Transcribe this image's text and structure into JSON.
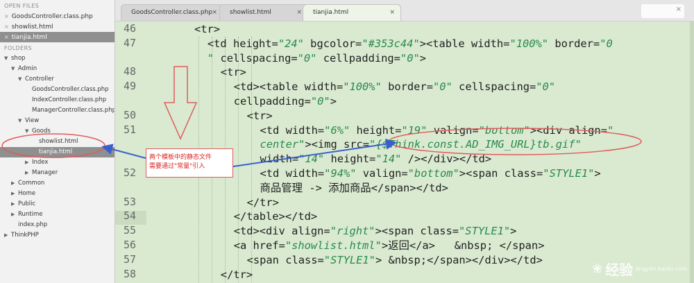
{
  "sidebar": {
    "open_files_header": "OPEN FILES",
    "open_files": [
      {
        "name": "GoodsController.class.php",
        "active": false
      },
      {
        "name": "showlist.html",
        "active": false
      },
      {
        "name": "tianjia.html",
        "active": true
      }
    ],
    "folders_header": "FOLDERS",
    "tree": [
      {
        "label": "shop",
        "depth": 0,
        "state": "open"
      },
      {
        "label": "Admin",
        "depth": 1,
        "state": "open"
      },
      {
        "label": "Controller",
        "depth": 2,
        "state": "open"
      },
      {
        "label": "GoodsController.class.php",
        "depth": 3,
        "state": "file"
      },
      {
        "label": "IndexController.class.php",
        "depth": 3,
        "state": "file"
      },
      {
        "label": "ManagerController.class.php",
        "depth": 3,
        "state": "file"
      },
      {
        "label": "View",
        "depth": 2,
        "state": "open"
      },
      {
        "label": "Goods",
        "depth": 3,
        "state": "open"
      },
      {
        "label": "showlist.html",
        "depth": 4,
        "state": "file"
      },
      {
        "label": "tianjia.html",
        "depth": 4,
        "state": "file",
        "selected": true
      },
      {
        "label": "Index",
        "depth": 3,
        "state": "closed"
      },
      {
        "label": "Manager",
        "depth": 3,
        "state": "closed"
      },
      {
        "label": "Common",
        "depth": 1,
        "state": "closed"
      },
      {
        "label": "Home",
        "depth": 1,
        "state": "closed"
      },
      {
        "label": "Public",
        "depth": 1,
        "state": "closed"
      },
      {
        "label": "Runtime",
        "depth": 1,
        "state": "closed"
      },
      {
        "label": "index.php",
        "depth": 1,
        "state": "file"
      },
      {
        "label": "ThinkPHP",
        "depth": 0,
        "state": "closed"
      }
    ]
  },
  "tabs": [
    {
      "label": "GoodsController.class.php",
      "close": "×",
      "active": false
    },
    {
      "label": "showlist.html",
      "close": "×",
      "active": false
    },
    {
      "label": "tianjia.html",
      "close": "×",
      "active": true
    }
  ],
  "tab_stub_close": "×",
  "editor": {
    "line_numbers": [
      "46",
      "47",
      "48",
      "49",
      "50",
      "51",
      "52",
      "53",
      "54",
      "55",
      "56",
      "57",
      "58"
    ],
    "current_line": "54",
    "code_lines": [
      [
        {
          "t": "<tr>"
        }
      ],
      [
        {
          "t": "<td height="
        },
        {
          "t": "\"24\"",
          "v": true
        },
        {
          "t": " bgcolor="
        },
        {
          "t": "\"#353c44\"",
          "v": true
        },
        {
          "t": "><table width="
        },
        {
          "t": "\"100%\"",
          "v": true
        },
        {
          "t": " border="
        },
        {
          "t": "\"0",
          "v": true
        }
      ],
      [
        {
          "t": "\"",
          "v": true
        },
        {
          "t": " cellspacing="
        },
        {
          "t": "\"0\"",
          "v": true
        },
        {
          "t": " cellpadding="
        },
        {
          "t": "\"0\"",
          "v": true
        },
        {
          "t": ">"
        }
      ],
      [
        {
          "t": "<tr>"
        }
      ],
      [
        {
          "t": "<td><table width="
        },
        {
          "t": "\"100%\"",
          "v": true
        },
        {
          "t": " border="
        },
        {
          "t": "\"0\"",
          "v": true
        },
        {
          "t": " cellspacing="
        },
        {
          "t": "\"0\"",
          "v": true
        }
      ],
      [
        {
          "t": "cellpadding="
        },
        {
          "t": "\"0\"",
          "v": true
        },
        {
          "t": ">"
        }
      ],
      [
        {
          "t": "<tr>"
        }
      ],
      [
        {
          "t": "<td width="
        },
        {
          "t": "\"6%\"",
          "v": true
        },
        {
          "t": " height="
        },
        {
          "t": "\"19\"",
          "v": true
        },
        {
          "t": " valign="
        },
        {
          "t": "\"bottom\"",
          "v": true
        },
        {
          "t": "><div align="
        },
        {
          "t": "\"",
          "v": true
        }
      ],
      [
        {
          "t": "center\"",
          "v": true
        },
        {
          "t": "><img src="
        },
        {
          "t": "\"{$Think.const.AD_IMG_URL}tb.gif\"",
          "v": true
        }
      ],
      [
        {
          "t": "width="
        },
        {
          "t": "\"14\"",
          "v": true
        },
        {
          "t": " height="
        },
        {
          "t": "\"14\"",
          "v": true
        },
        {
          "t": " /></div></td>"
        }
      ],
      [
        {
          "t": "<td width="
        },
        {
          "t": "\"94%\"",
          "v": true
        },
        {
          "t": " valign="
        },
        {
          "t": "\"bottom\"",
          "v": true
        },
        {
          "t": "><span class="
        },
        {
          "t": "\"STYLE1\"",
          "v": true
        },
        {
          "t": ">"
        }
      ],
      [
        {
          "t": "商品管理 -> 添加商品</span></td>"
        }
      ],
      [
        {
          "t": "</tr>"
        }
      ],
      [
        {
          "t": "</table></td>"
        }
      ],
      [
        {
          "t": "<td><div align="
        },
        {
          "t": "\"right\"",
          "v": true
        },
        {
          "t": "><span class="
        },
        {
          "t": "\"STYLE1\"",
          "v": true
        },
        {
          "t": ">"
        }
      ],
      [
        {
          "t": "<a href="
        },
        {
          "t": "\"showlist.html\"",
          "v": true
        },
        {
          "t": ">返回</a>   &nbsp; </span>"
        }
      ],
      [
        {
          "t": "<span class="
        },
        {
          "t": "\"STYLE1\"",
          "v": true
        },
        {
          "t": "> &nbsp;</span></div></td>"
        }
      ],
      [
        {
          "t": "</tr>"
        }
      ]
    ]
  },
  "annotation": {
    "text_line1": "两个模板中的静态文件",
    "text_line2": "需要通过\"常量\"引入"
  },
  "watermark": {
    "text": "经验",
    "sub": "jingyan.baidu.com"
  },
  "colors": {
    "editor_bg": "#d9ead0",
    "string": "#2a8a4d",
    "annotation_red": "#e05a5a",
    "arrow_blue": "#3a5fcd"
  }
}
